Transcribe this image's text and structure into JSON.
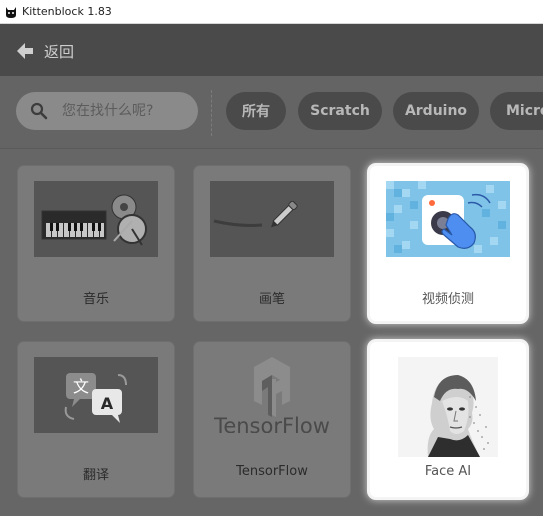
{
  "window": {
    "title": "Kittenblock 1.83",
    "icon": "cat-icon"
  },
  "header": {
    "back_label": "返回",
    "back_icon": "left-arrow-icon"
  },
  "search": {
    "placeholder": "您在找什么呢?",
    "icon": "search-icon"
  },
  "filters": [
    {
      "label": "所有"
    },
    {
      "label": "Scratch"
    },
    {
      "label": "Arduino"
    },
    {
      "label": "Micro"
    }
  ],
  "extensions": [
    {
      "label": "音乐",
      "icon": "music-instruments-icon",
      "selected": false
    },
    {
      "label": "画笔",
      "icon": "pen-icon",
      "selected": false
    },
    {
      "label": "视频侦测",
      "icon": "video-sensing-icon",
      "selected": true
    },
    {
      "label": "翻译",
      "icon": "translate-icon",
      "thumb_text_1": "文",
      "thumb_text_2": "A",
      "selected": false
    },
    {
      "label": "TensorFlow",
      "icon": "tensorflow-logo-icon",
      "logo_text": "TensorFlow",
      "selected": false
    },
    {
      "label": "Face AI",
      "icon": "face-ai-icon",
      "selected": true
    }
  ],
  "colors": {
    "header": "#4a4a4a",
    "overlay": "#6e6e6e",
    "selected_card": "#ffffff",
    "video_thumb_bg": "#7fc4e8"
  }
}
